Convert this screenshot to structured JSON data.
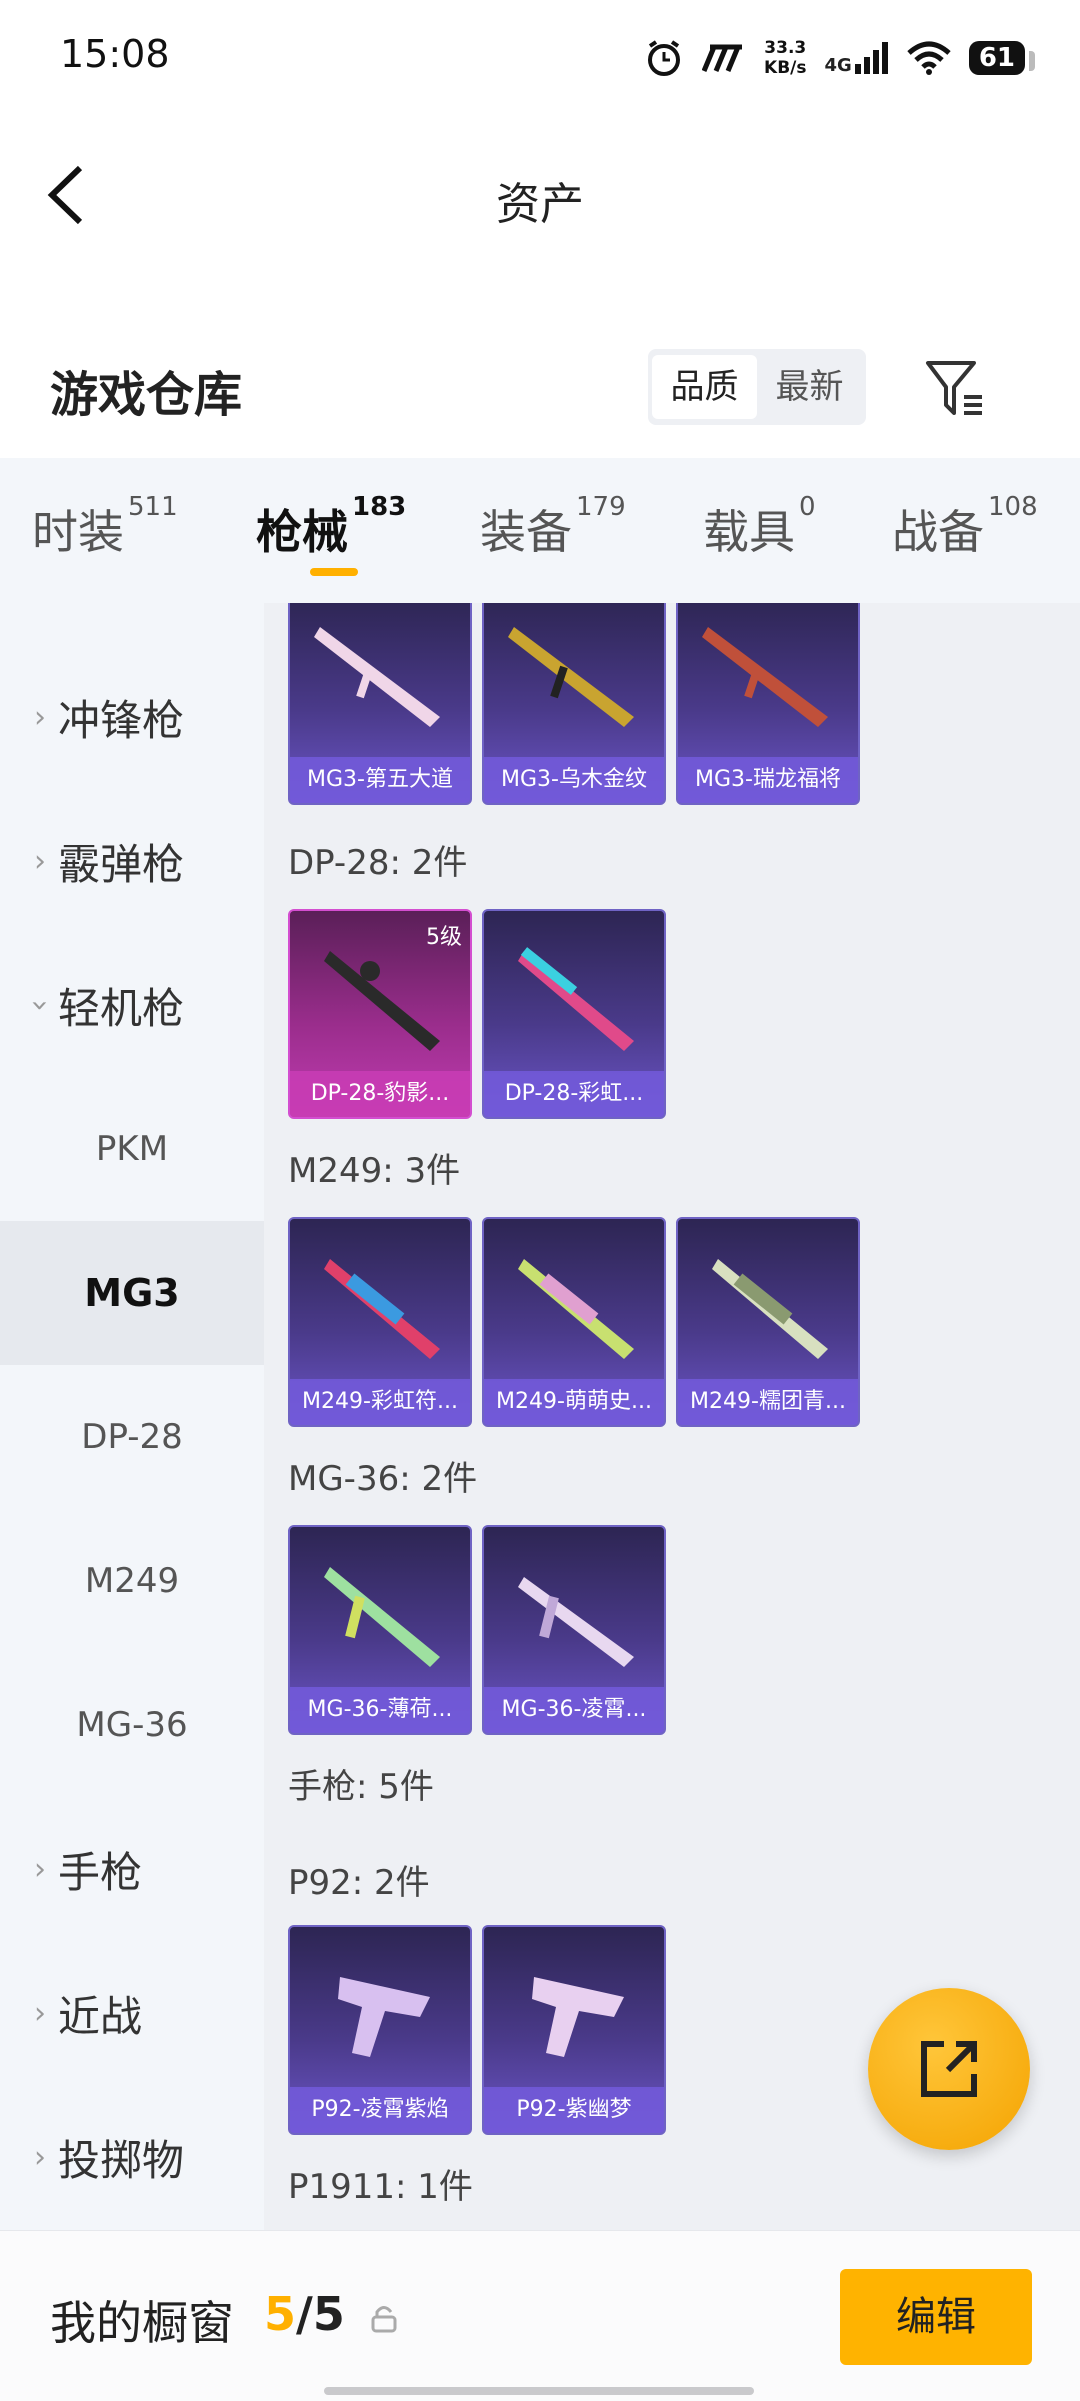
{
  "status": {
    "time": "15:08",
    "net_speed": "33.3",
    "net_unit": "KB/s",
    "network_type": "4G",
    "battery": "61"
  },
  "nav": {
    "title": "资产"
  },
  "warehouse": {
    "title": "游戏仓库",
    "sort_options": [
      "品质",
      "最新"
    ],
    "active_sort": "品质"
  },
  "tabs": [
    {
      "label": "时装",
      "count": "511"
    },
    {
      "label": "枪械",
      "count": "183"
    },
    {
      "label": "装备",
      "count": "179"
    },
    {
      "label": "载具",
      "count": "0"
    },
    {
      "label": "战备",
      "count": "108"
    }
  ],
  "sidebar": {
    "categories": [
      "冲锋枪",
      "霰弹枪",
      "轻机枪",
      "手枪",
      "近战",
      "投掷物"
    ],
    "subcategories": [
      "PKM",
      "MG3",
      "DP-28",
      "M249",
      "MG-36"
    ],
    "active_subcategory": "MG3"
  },
  "groups": {
    "dp28": "DP-28: 2件",
    "m249": "M249: 3件",
    "mg36": "MG-36: 2件",
    "pistol": "手枪: 5件",
    "p92": "P92: 2件",
    "p1911": "P1911: 1件"
  },
  "items": {
    "mg3": [
      "MG3-第五大道",
      "MG3-乌木金纹",
      "MG3-瑞龙福将"
    ],
    "dp28": [
      "DP-28-豹影...",
      "DP-28-彩虹..."
    ],
    "dp28_level": "5级",
    "m249": [
      "M249-彩虹符...",
      "M249-萌萌史...",
      "M249-糯团青..."
    ],
    "mg36": [
      "MG-36-薄荷...",
      "MG-36-凌霄..."
    ],
    "p92": [
      "P92-凌霄紫焰",
      "P92-紫幽梦"
    ]
  },
  "bottom": {
    "showcase_label": "我的橱窗",
    "showcase_used": "5",
    "showcase_sep": "/",
    "showcase_total": "5",
    "edit_label": "编辑"
  },
  "colors": {
    "accent": "#ffb000",
    "card_purple": "#4a3a8a",
    "card_pink": "#c03cb0"
  }
}
